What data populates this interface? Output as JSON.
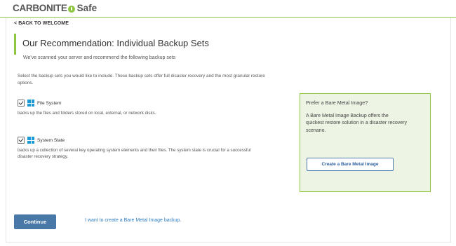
{
  "header": {
    "brand": "CARBONITE",
    "product": "Safe",
    "colors": {
      "accent": "#8dc63f",
      "button": "#4878a8",
      "link": "#2f7cc0"
    }
  },
  "nav": {
    "back_label": "< BACK TO WELCOME"
  },
  "main": {
    "title": "Our Recommendation: Individual Backup Sets",
    "subtitle": "We've scanned your server and recommend the following backup sets",
    "intro": "Select the backup sets you would like to include.  These backup sets offer full disaster recovery and the most granular restore options.",
    "options": [
      {
        "label": "File System",
        "checked": true,
        "icon": "windows-icon",
        "description": "backs up the files and folders stored on local, external, or network disks."
      },
      {
        "label": "System State",
        "checked": true,
        "icon": "windows-icon",
        "description": "backs up a collection of several key operating system elements and their files. The system state is crucial for a successful disaster recovery strategy."
      }
    ]
  },
  "panel": {
    "title": "Prefer a Bare Metal Image?",
    "text": "A Bare Metal Image Backup offers the quickest restore solution in a disaster recovery scenario.",
    "button_label": "Create a Bare Metal Image"
  },
  "footer": {
    "continue_label": "Continue",
    "link_label": "I want to create a Bare Metal Image backup."
  }
}
